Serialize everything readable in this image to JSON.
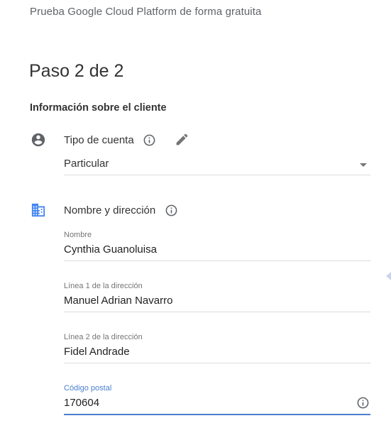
{
  "header": {
    "trial_title": "Prueba Google Cloud Platform de forma gratuita"
  },
  "step": {
    "title": "Paso 2 de 2"
  },
  "section": {
    "heading": "Información sobre el cliente"
  },
  "account_type": {
    "icon": "account-circle-icon",
    "label": "Tipo de cuenta",
    "info_icon": "info-icon",
    "edit_icon": "pencil-icon",
    "selected_value": "Particular"
  },
  "name_address": {
    "icon": "business-building-icon",
    "label": "Nombre y dirección",
    "info_icon": "info-icon",
    "fields": [
      {
        "label": "Nombre",
        "value": "Cynthia Guanoluisa"
      },
      {
        "label": "Línea 1 de la dirección",
        "value": "Manuel Adrian Navarro"
      },
      {
        "label": "Línea 2 de la dirección",
        "value": "Fidel Andrade"
      },
      {
        "label": "Código postal",
        "value": "170604"
      }
    ]
  },
  "colors": {
    "accent": "#4a7fd0",
    "icon_gray": "#5f6368",
    "building_blue": "#4285f4",
    "divider": "#dadce0"
  }
}
